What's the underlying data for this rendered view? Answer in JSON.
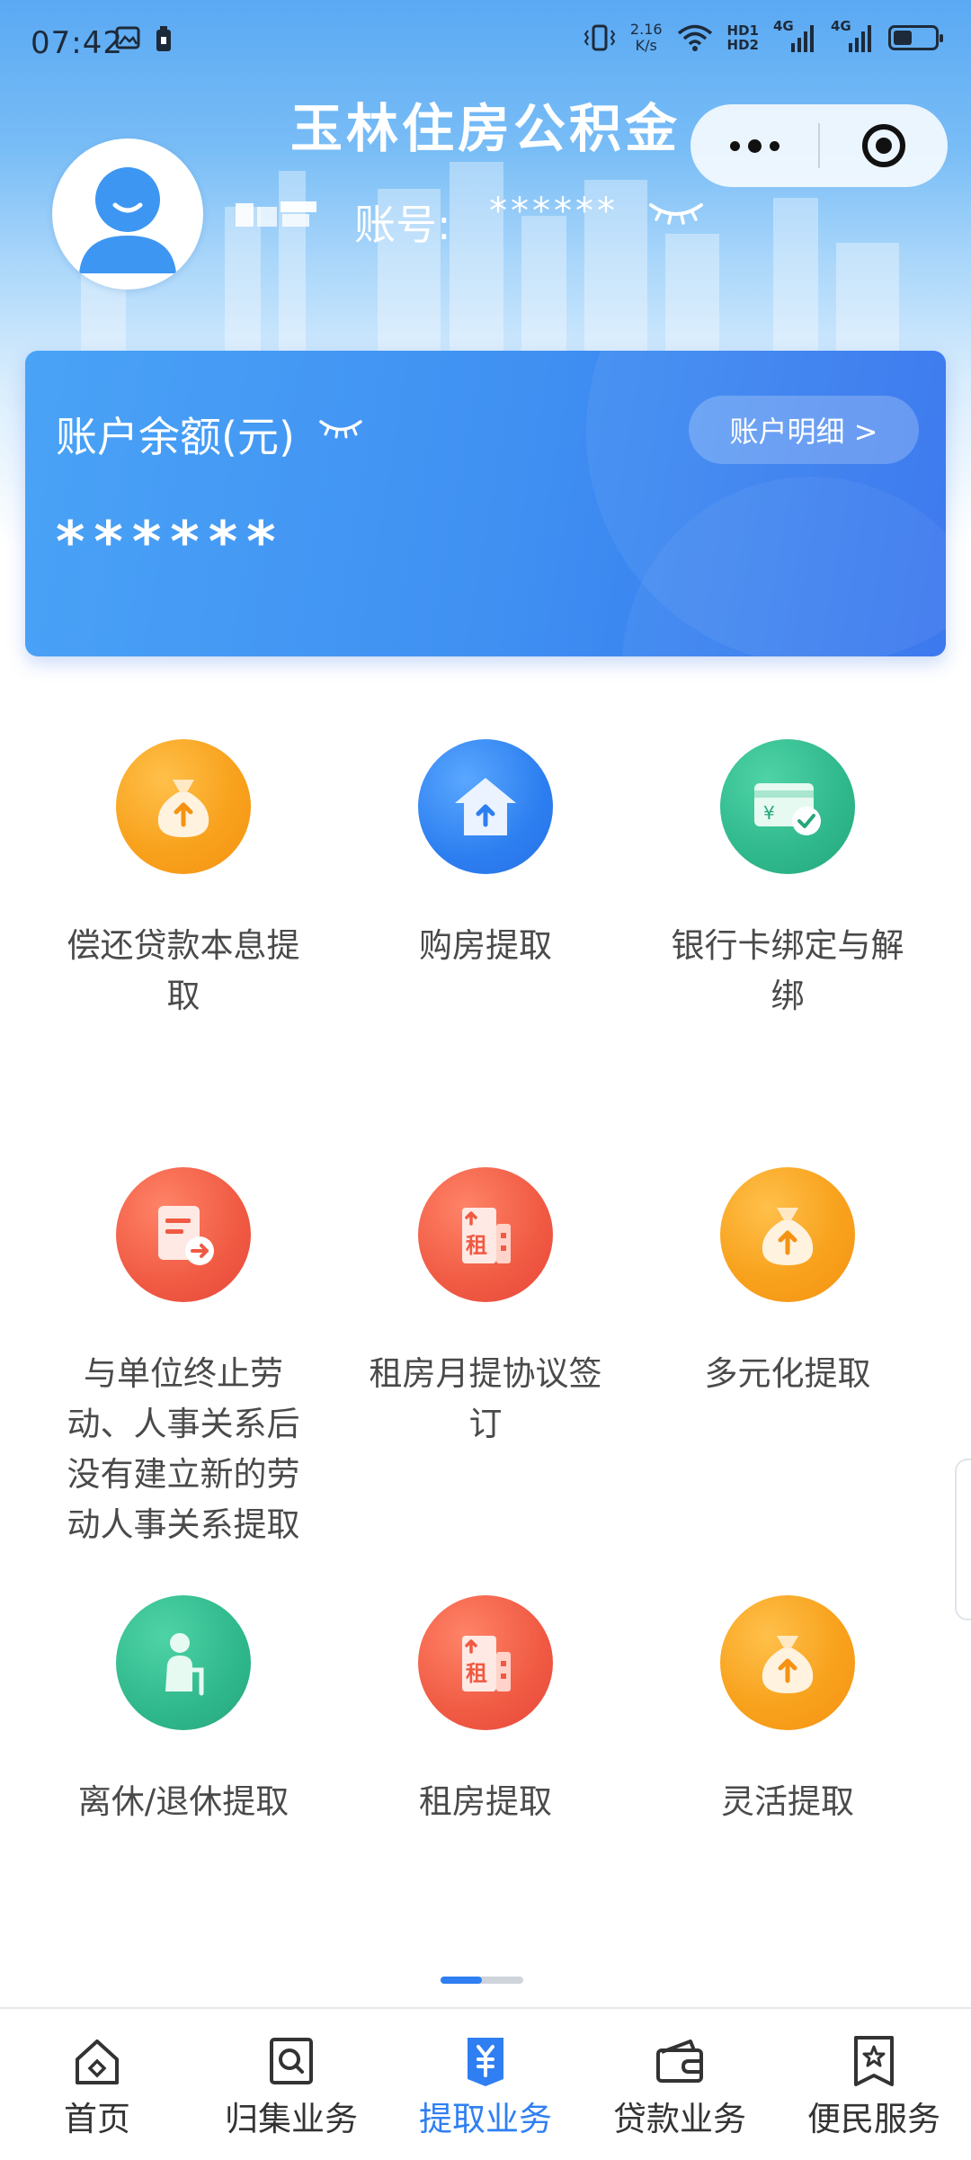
{
  "status_bar": {
    "time": "07:42",
    "net_speed_value": "2.16",
    "net_speed_unit": "K/s",
    "hd1": "HD1",
    "hd2": "HD2",
    "signal1_label": "4G",
    "signal2_label": "4G",
    "battery_level": 0.45
  },
  "header": {
    "title": "玉林住房公积金",
    "account_label": "账号:",
    "account_value": "******"
  },
  "balance_card": {
    "label": "账户余额(元)",
    "detail_button": "账户明细 >",
    "value": "******"
  },
  "services": [
    {
      "label": "偿还贷款本息提取",
      "icon": "money-bag-icon",
      "color": "orange"
    },
    {
      "label": "购房提取",
      "icon": "house-upload-icon",
      "color": "blue"
    },
    {
      "label": "银行卡绑定与解绑",
      "icon": "bank-card-check-icon",
      "color": "green"
    },
    {
      "label": "与单位终止劳动、人事关系后没有建立新的劳动人事关系提取",
      "icon": "document-exit-icon",
      "color": "red"
    },
    {
      "label": "租房月提协议签订",
      "icon": "rent-building-icon",
      "color": "red"
    },
    {
      "label": "多元化提取",
      "icon": "money-bag-icon",
      "color": "orange"
    },
    {
      "label": "离休/退休提取",
      "icon": "elderly-person-icon",
      "color": "green"
    },
    {
      "label": "租房提取",
      "icon": "rent-building-icon",
      "color": "red"
    },
    {
      "label": "灵活提取",
      "icon": "money-bag-icon",
      "color": "orange"
    }
  ],
  "rent_char": "租",
  "yen_char": "¥",
  "pager": {
    "pages": 2,
    "current": 1
  },
  "tab_bar": {
    "tabs": [
      {
        "label": "首页",
        "icon": "home-icon",
        "active": false
      },
      {
        "label": "归集业务",
        "icon": "search-doc-icon",
        "active": false
      },
      {
        "label": "提取业务",
        "icon": "yen-bookmark-icon",
        "active": true
      },
      {
        "label": "贷款业务",
        "icon": "wallet-icon",
        "active": false
      },
      {
        "label": "便民服务",
        "icon": "star-bookmark-icon",
        "active": false
      }
    ]
  },
  "colors": {
    "accent": "#2f7ff2",
    "orange": "#f8a21d",
    "blue": "#2d7ff0",
    "green": "#2fb88c",
    "red": "#f05a43"
  }
}
